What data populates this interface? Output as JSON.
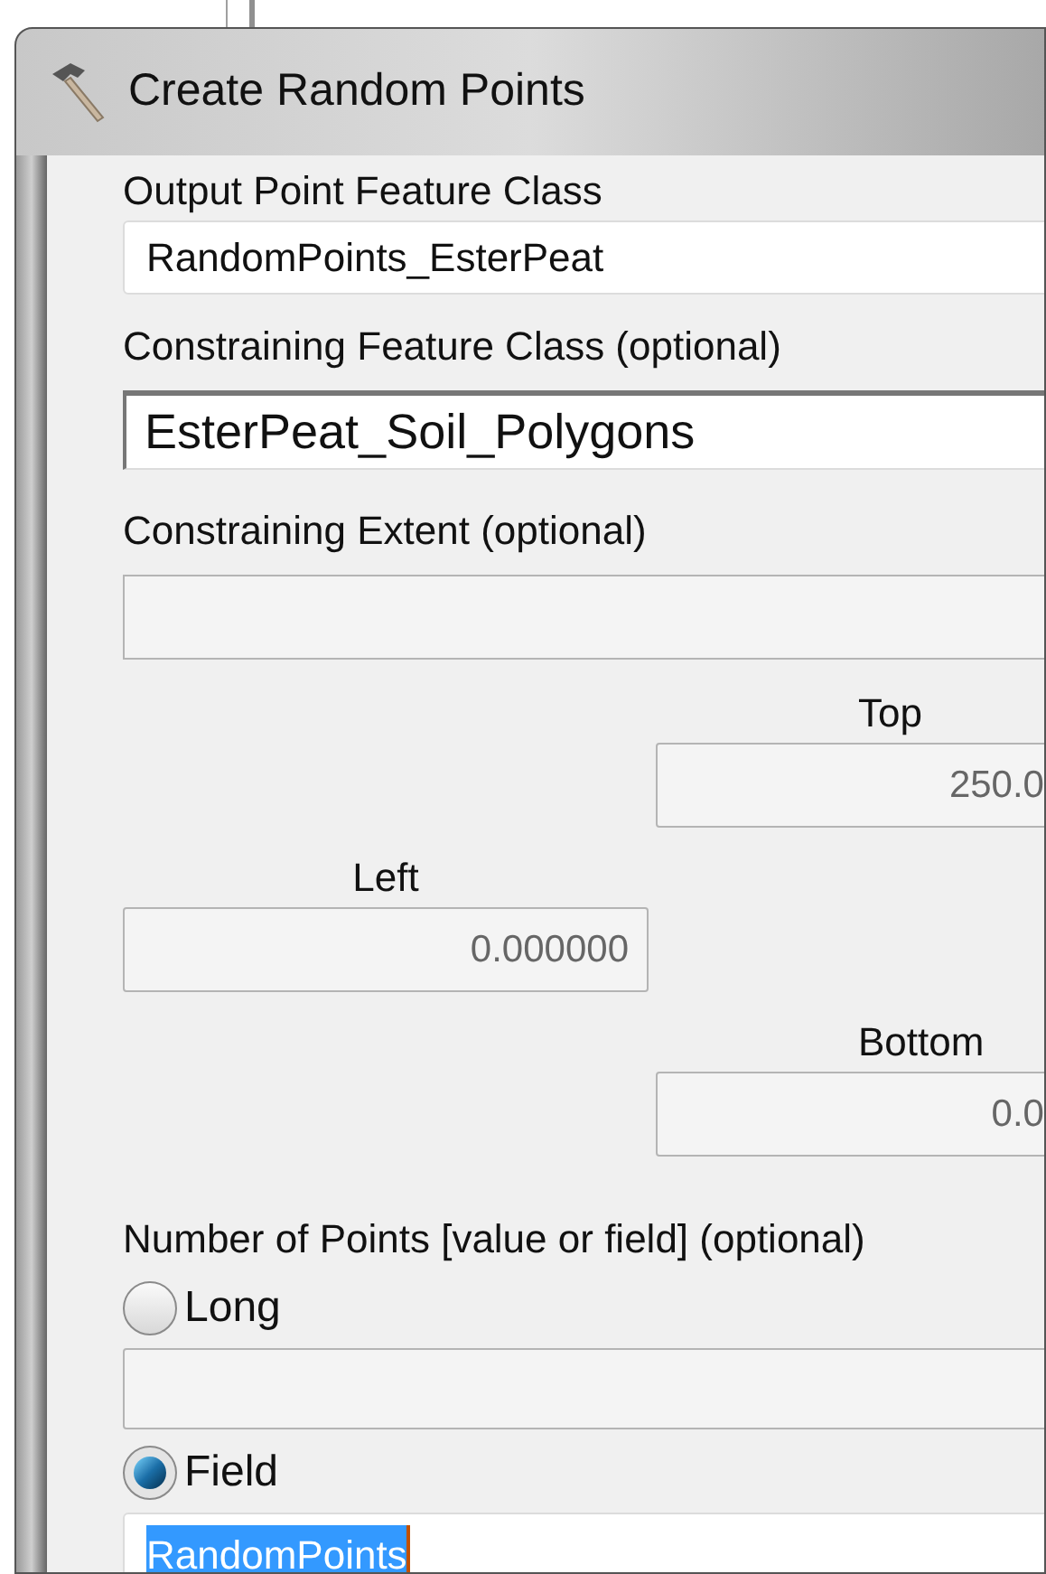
{
  "window": {
    "title": "Create Random Points"
  },
  "output_feature_class": {
    "label": "Output Point Feature Class",
    "value": "RandomPoints_EsterPeat"
  },
  "constraining_feature_class": {
    "label": "Constraining Feature Class (optional)",
    "value": "EsterPeat_Soil_Polygons"
  },
  "constraining_extent": {
    "label": "Constraining Extent (optional)",
    "disabled": true,
    "top": {
      "label": "Top",
      "value": "250.0"
    },
    "left": {
      "label": "Left",
      "value": "0.000000"
    },
    "bottom": {
      "label": "Bottom",
      "value": "0.0"
    }
  },
  "number_of_points": {
    "label": "Number of Points [value or field] (optional)",
    "options": [
      {
        "label": "Long",
        "selected": false,
        "value_disabled": true
      },
      {
        "label": "Field",
        "selected": true,
        "value": "RandomPoints",
        "value_selected": true
      }
    ]
  }
}
